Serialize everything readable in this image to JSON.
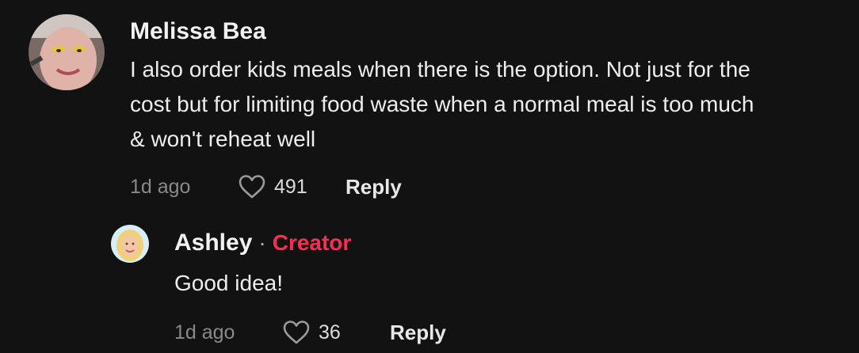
{
  "comment": {
    "username": "Melissa Bea",
    "text_lines": [
      "I also order kids meals when there is the option. Not just for the",
      "cost but for limiting food waste when a normal meal is too much",
      "& won't reheat well"
    ],
    "time": "1d ago",
    "likes": "491",
    "reply_label": "Reply",
    "avatar_icon": "user-avatar-melissa",
    "like_icon": "heart-outline-icon"
  },
  "reply": {
    "username": "Ashley",
    "separator": "·",
    "badge": "Creator",
    "badge_color": "#fe2c55",
    "text": "Good idea!",
    "time": "1d ago",
    "likes": "36",
    "reply_label": "Reply",
    "avatar_icon": "user-avatar-ashley",
    "like_icon": "heart-outline-icon"
  }
}
